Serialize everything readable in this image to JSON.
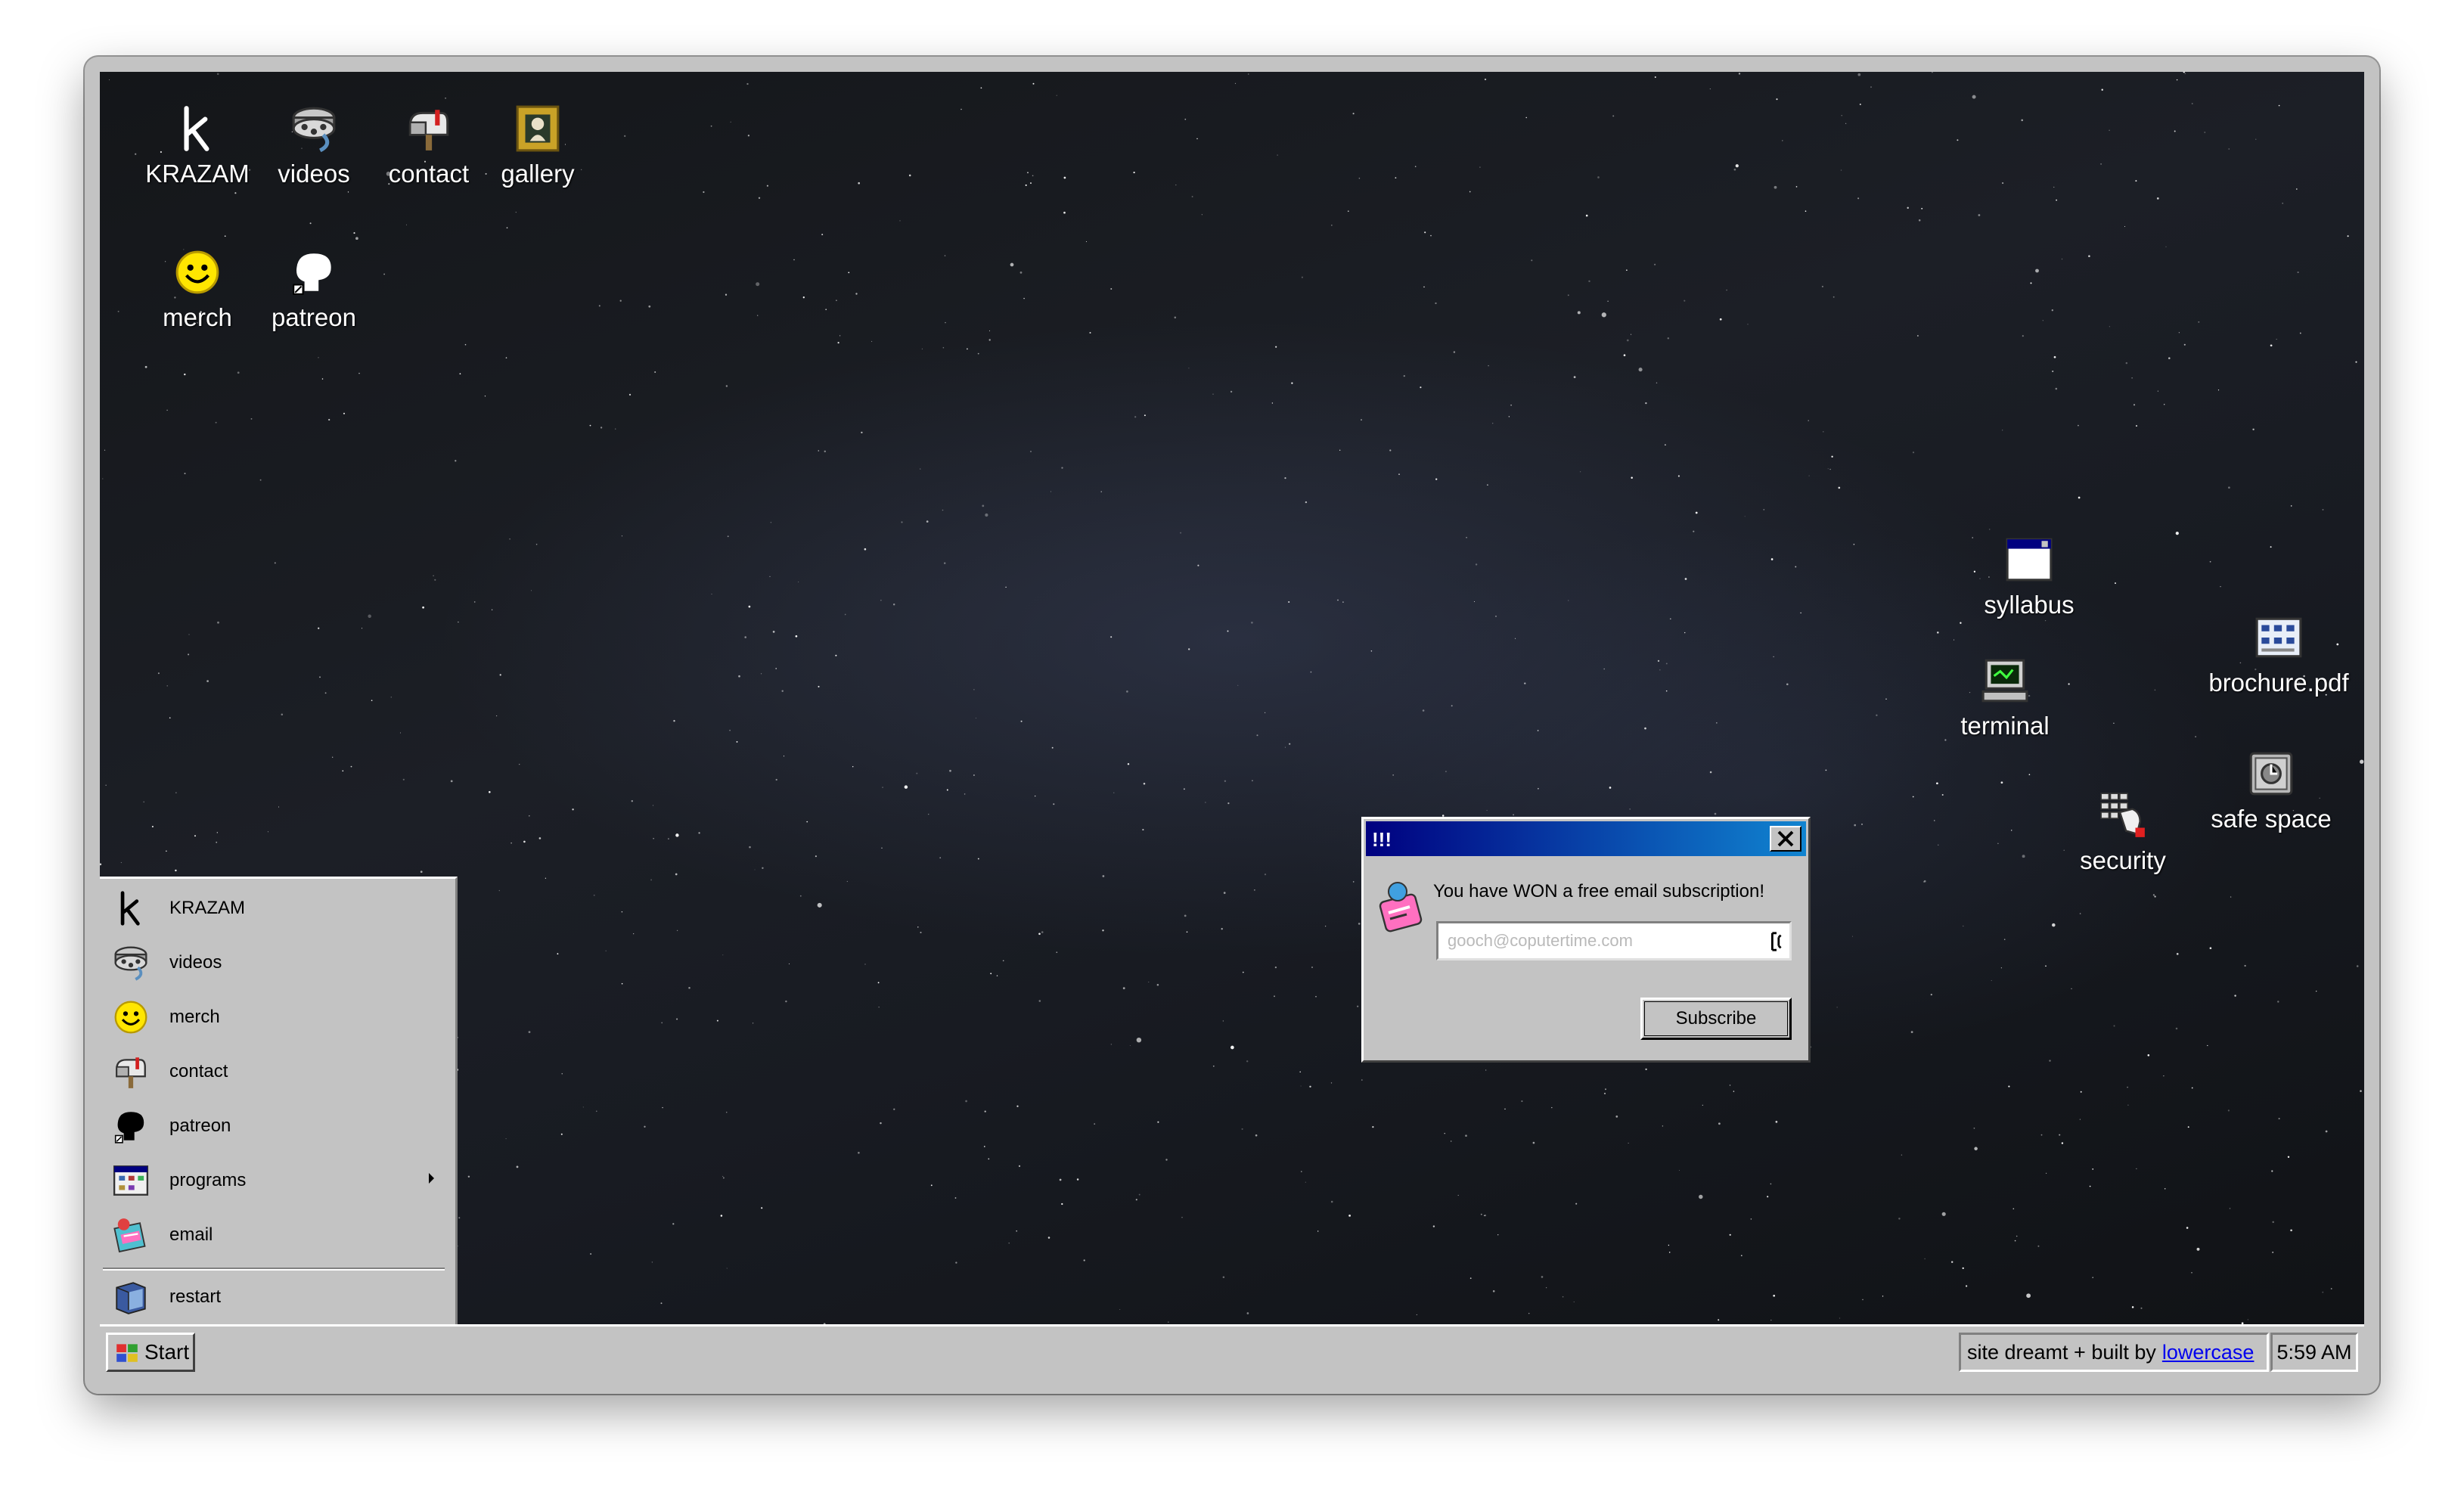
{
  "desktop": {
    "icons": [
      {
        "label": "KRAZAM",
        "icon": "krazam-k-icon"
      },
      {
        "label": "videos",
        "icon": "film-reel-icon"
      },
      {
        "label": "contact",
        "icon": "mailbox-icon"
      },
      {
        "label": "gallery",
        "icon": "picture-frame-icon"
      },
      {
        "label": "merch",
        "icon": "smiley-icon"
      },
      {
        "label": "patreon",
        "icon": "patreon-head-icon"
      },
      {
        "label": "syllabus",
        "icon": "window-icon"
      },
      {
        "label": "brochure.pdf",
        "icon": "document-icon"
      },
      {
        "label": "terminal",
        "icon": "computer-icon"
      },
      {
        "label": "safe space",
        "icon": "safe-icon"
      },
      {
        "label": "security",
        "icon": "keypad-hand-icon"
      }
    ]
  },
  "start_menu": {
    "items": [
      {
        "label": "KRAZAM",
        "icon": "krazam-k-icon"
      },
      {
        "label": "videos",
        "icon": "film-reel-icon"
      },
      {
        "label": "merch",
        "icon": "smiley-icon"
      },
      {
        "label": "contact",
        "icon": "mailbox-icon"
      },
      {
        "label": "patreon",
        "icon": "patreon-head-icon"
      },
      {
        "label": "programs",
        "icon": "programs-icon",
        "has_submenu": true
      },
      {
        "label": "email",
        "icon": "email-icon"
      }
    ],
    "restart": {
      "label": "restart",
      "icon": "restart-icon"
    }
  },
  "taskbar": {
    "start_label": "Start",
    "credit_text": "site dreamt + built by",
    "credit_link": "lowercase",
    "clock": "5:59 AM"
  },
  "dialog": {
    "title": "!!!",
    "message": "You have WON a free email subscription!",
    "email_placeholder": "gooch@coputertime.com",
    "email_value": "",
    "subscribe_label": "Subscribe"
  },
  "colors": {
    "titlebar_start": "#000080",
    "titlebar_end": "#1084d0",
    "chrome": "#c3c3c3",
    "link": "#0000ee",
    "smiley": "#ffe600"
  }
}
